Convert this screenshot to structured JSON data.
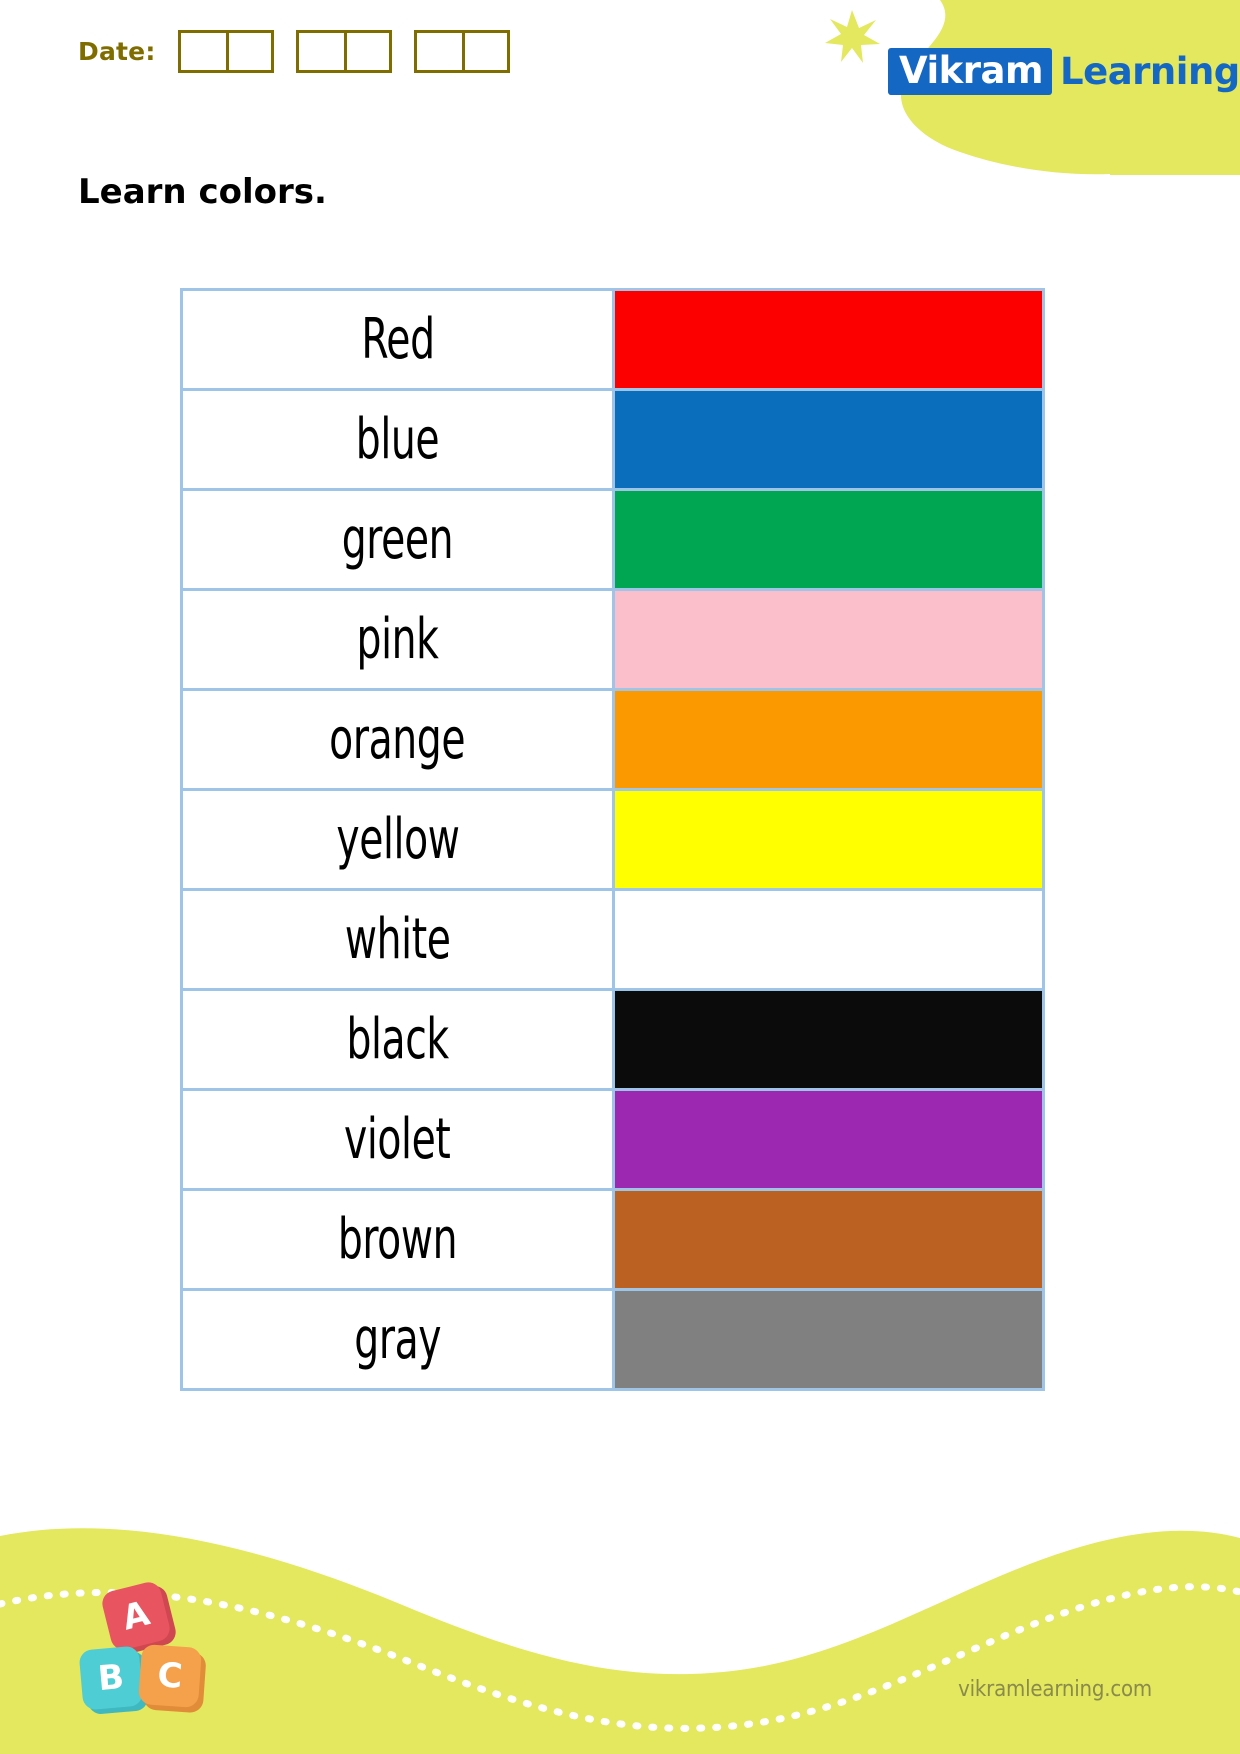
{
  "header": {
    "date_label": "Date:",
    "date_boxes_groups": 3,
    "date_cells_per_group": 2,
    "date_color": "#806d00",
    "logo": {
      "brand_primary": "Vikram",
      "brand_secondary": "Learning",
      "brand_blue": "#1567c4",
      "blob_color": "#e3e85e",
      "star_icon": "star-icon"
    }
  },
  "title": "Learn colors.",
  "table": {
    "border_color": "#9ec4e8",
    "rows": [
      {
        "word": "Red",
        "color": "#fc0000"
      },
      {
        "word": "blue",
        "color": "#0a6ebd"
      },
      {
        "word": "green",
        "color": "#00a651"
      },
      {
        "word": "pink",
        "color": "#fbbfcc"
      },
      {
        "word": "orange",
        "color": "#fb9a00"
      },
      {
        "word": "yellow",
        "color": "#ffff00"
      },
      {
        "word": "white",
        "color": "#ffffff"
      },
      {
        "word": "black",
        "color": "#0b0b0b"
      },
      {
        "word": "violet",
        "color": "#9c27b0"
      },
      {
        "word": "brown",
        "color": "#bb6121"
      },
      {
        "word": "gray",
        "color": "#808080"
      }
    ]
  },
  "footer": {
    "url": "vikramlearning.com",
    "wave_color": "#e3e85e",
    "dotted_line_color": "#ffffff",
    "blocks": [
      {
        "letter": "A",
        "color": "#e8545f"
      },
      {
        "letter": "B",
        "color": "#4ecdd4"
      },
      {
        "letter": "C",
        "color": "#f5a04a"
      }
    ]
  }
}
